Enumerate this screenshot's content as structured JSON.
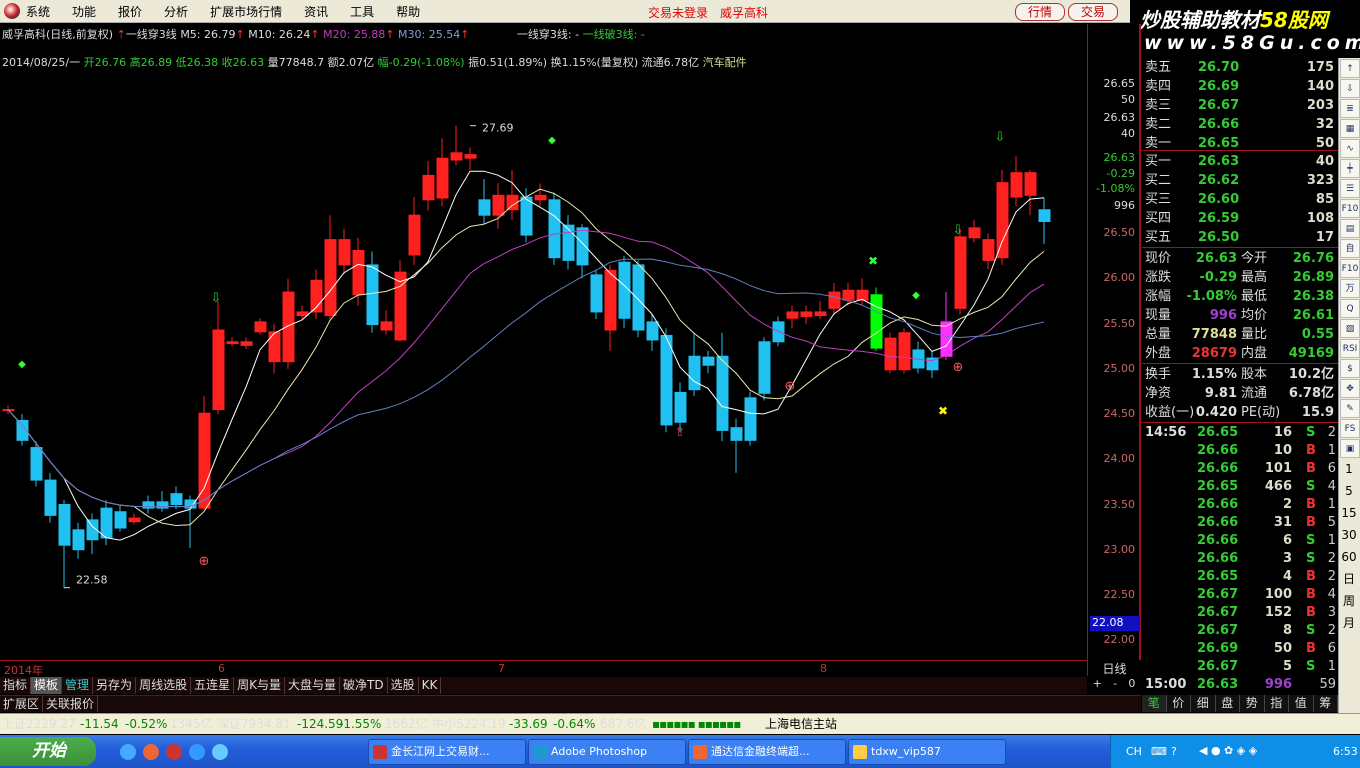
{
  "menu": {
    "items": [
      "系统",
      "功能",
      "报价",
      "分析",
      "扩展市场行情",
      "资讯",
      "工具",
      "帮助"
    ],
    "status": "交易未登录",
    "stock": "威孚高科",
    "btn_quote": "行情",
    "btn_trade": "交易"
  },
  "watermark": {
    "line1_a": "炒股辅助教材",
    "line1_b": "58股网",
    "line2": "www.58Gu.com"
  },
  "info_line1": {
    "title": "威孚高科(日线,前复权)",
    "ind1": "一线穿3线",
    "m5": "M5: 26.79",
    "m10": "M10: 26.24",
    "m20": "M20: 25.88",
    "m30": "M30: 25.54",
    "sig_a": "一线穿3线: -",
    "sig_b": "一线破3线: -"
  },
  "info_line2": {
    "date": "2014/08/25/一",
    "open": "开26.76",
    "high": "高26.89",
    "low": "低26.38",
    "close": "收26.63",
    "vol": "量77848.7",
    "amt": "额2.07亿",
    "chg": "幅-0.29(-1.08%)",
    "amp": "振0.51(1.89%)",
    "turn": "换1.15%(量复权)",
    "float": "流通6.78亿",
    "sector": "汽车配件"
  },
  "colors": {
    "up": "#ff2020",
    "down": "#20c0f0",
    "ma5": "#ffffff",
    "ma10": "#e8e8b0",
    "ma20": "#c040c0",
    "ma30": "#6080c0",
    "special_green": "#00ff00",
    "special_magenta": "#ff30ff"
  },
  "chart_data": {
    "type": "candlestick",
    "ylim": [
      21.85,
      28.2
    ],
    "y_ticks": [
      "26.50",
      "26.00",
      "25.50",
      "25.00",
      "24.50",
      "24.00",
      "23.50",
      "23.00",
      "22.50",
      "22.00"
    ],
    "y_tick_values": [
      26.5,
      26.0,
      25.5,
      25.0,
      24.5,
      24.0,
      23.5,
      23.0,
      22.5,
      22.0
    ],
    "x_labels": [
      "2014年",
      "6",
      "7",
      "8"
    ],
    "x_label_index": [
      0,
      15,
      35,
      58
    ],
    "high_label": "27.69",
    "high_index": 33,
    "low_label": "22.58",
    "low_index": 4,
    "ohlc": [
      [
        24.54,
        24.55,
        24.6,
        24.5
      ],
      [
        24.43,
        24.21,
        24.5,
        24.15
      ],
      [
        24.13,
        23.77,
        24.2,
        23.7
      ],
      [
        23.77,
        23.38,
        23.85,
        23.3
      ],
      [
        23.5,
        23.05,
        23.55,
        22.58
      ],
      [
        23.22,
        23.0,
        23.3,
        22.9
      ],
      [
        23.33,
        23.11,
        23.4,
        22.95
      ],
      [
        23.46,
        23.13,
        23.55,
        23.05
      ],
      [
        23.42,
        23.24,
        23.5,
        23.2
      ],
      [
        23.31,
        23.35,
        23.4,
        23.28
      ],
      [
        23.53,
        23.46,
        23.6,
        23.4
      ],
      [
        23.53,
        23.46,
        23.65,
        23.42
      ],
      [
        23.62,
        23.5,
        23.7,
        23.45
      ],
      [
        23.55,
        23.46,
        23.6,
        23.02
      ],
      [
        23.46,
        24.51,
        24.7,
        23.44
      ],
      [
        24.55,
        25.43,
        25.75,
        24.5
      ],
      [
        25.28,
        25.3,
        25.35,
        25.25
      ],
      [
        25.26,
        25.3,
        25.35,
        25.22
      ],
      [
        25.41,
        25.52,
        25.56,
        25.38
      ],
      [
        25.08,
        25.41,
        25.5,
        24.95
      ],
      [
        25.08,
        25.85,
        26.0,
        25.0
      ],
      [
        25.59,
        25.63,
        25.7,
        25.55
      ],
      [
        25.63,
        25.98,
        26.1,
        25.55
      ],
      [
        25.59,
        26.43,
        26.7,
        25.55
      ],
      [
        26.15,
        26.43,
        26.55,
        26.05
      ],
      [
        25.82,
        26.31,
        26.45,
        25.7
      ],
      [
        26.15,
        25.49,
        26.3,
        25.4
      ],
      [
        25.43,
        25.52,
        25.65,
        25.38
      ],
      [
        25.32,
        26.07,
        26.2,
        25.3
      ],
      [
        26.26,
        26.7,
        26.9,
        26.15
      ],
      [
        26.87,
        27.14,
        27.3,
        26.75
      ],
      [
        26.89,
        27.33,
        27.55,
        26.8
      ],
      [
        27.31,
        27.39,
        27.69,
        27.25
      ],
      [
        27.33,
        27.37,
        27.45,
        27.2
      ],
      [
        26.87,
        26.7,
        27.1,
        26.6
      ],
      [
        26.7,
        26.92,
        27.05,
        26.55
      ],
      [
        26.76,
        26.92,
        27.2,
        26.65
      ],
      [
        26.9,
        26.48,
        27.0,
        26.4
      ],
      [
        26.87,
        26.92,
        27.05,
        26.8
      ],
      [
        26.87,
        26.23,
        26.95,
        26.15
      ],
      [
        26.59,
        26.2,
        26.7,
        26.1
      ],
      [
        26.56,
        26.15,
        26.6,
        26.0
      ],
      [
        26.04,
        25.63,
        26.1,
        25.55
      ],
      [
        25.43,
        26.09,
        26.15,
        25.2
      ],
      [
        26.18,
        25.56,
        26.25,
        25.45
      ],
      [
        26.15,
        25.43,
        26.2,
        25.35
      ],
      [
        25.52,
        25.32,
        25.6,
        25.2
      ],
      [
        25.37,
        24.38,
        25.45,
        24.3
      ],
      [
        24.74,
        24.41,
        24.85,
        24.3
      ],
      [
        25.14,
        24.77,
        25.4,
        24.7
      ],
      [
        25.13,
        25.04,
        25.2,
        24.95
      ],
      [
        25.14,
        24.32,
        25.4,
        24.2
      ],
      [
        24.35,
        24.21,
        24.45,
        23.85
      ],
      [
        24.68,
        24.21,
        24.75,
        24.15
      ],
      [
        25.3,
        24.73,
        25.35,
        24.65
      ],
      [
        25.52,
        25.3,
        25.58,
        25.25
      ],
      [
        25.56,
        25.63,
        25.7,
        25.45
      ],
      [
        25.58,
        25.63,
        25.7,
        25.5
      ],
      [
        25.59,
        25.63,
        25.75,
        25.55
      ],
      [
        25.67,
        25.85,
        25.95,
        25.6
      ],
      [
        25.76,
        25.87,
        25.95,
        25.7
      ],
      [
        25.76,
        25.87,
        26.0,
        25.7
      ],
      [
        25.82,
        25.23,
        25.9,
        25.2
      ],
      [
        24.99,
        25.34,
        25.4,
        24.95
      ],
      [
        24.99,
        25.4,
        25.45,
        24.95
      ],
      [
        25.21,
        25.01,
        25.3,
        24.95
      ],
      [
        25.12,
        24.99,
        25.2,
        24.9
      ],
      [
        25.14,
        25.52,
        25.85,
        25.1
      ],
      [
        25.67,
        26.46,
        26.55,
        25.6
      ],
      [
        26.45,
        26.56,
        26.65,
        26.4
      ],
      [
        26.2,
        26.43,
        26.5,
        26.1
      ],
      [
        26.23,
        27.06,
        27.2,
        26.15
      ],
      [
        26.9,
        27.17,
        27.35,
        26.8
      ],
      [
        26.92,
        27.17,
        27.2,
        26.7
      ],
      [
        26.76,
        26.63,
        26.89,
        26.38
      ]
    ],
    "special": {
      "62": "special_green",
      "67": "special_magenta"
    },
    "ma_periods": [
      5,
      10,
      20,
      30
    ]
  },
  "yaxis": {
    "top_block": [
      "26.65",
      "50",
      "26.63",
      "40",
      "26.63",
      "-0.29",
      "-1.08%",
      "996"
    ],
    "current": "22.08",
    "dayline": "日线",
    "zoom": [
      "+",
      "-",
      "0"
    ]
  },
  "orderbook": {
    "sells": [
      {
        "label": "卖五",
        "price": "26.70",
        "vol": "175"
      },
      {
        "label": "卖四",
        "price": "26.69",
        "vol": "140"
      },
      {
        "label": "卖三",
        "price": "26.67",
        "vol": "203"
      },
      {
        "label": "卖二",
        "price": "26.66",
        "vol": "32"
      },
      {
        "label": "卖一",
        "price": "26.65",
        "vol": "50"
      }
    ],
    "buys": [
      {
        "label": "买一",
        "price": "26.63",
        "vol": "40"
      },
      {
        "label": "买二",
        "price": "26.62",
        "vol": "323"
      },
      {
        "label": "买三",
        "price": "26.60",
        "vol": "85"
      },
      {
        "label": "买四",
        "price": "26.59",
        "vol": "108"
      },
      {
        "label": "买五",
        "price": "26.50",
        "vol": "17"
      }
    ]
  },
  "quote": [
    {
      "l": "现价",
      "a": "26.63",
      "ac": "#3c3",
      "l2": "今开",
      "b": "26.76"
    },
    {
      "l": "涨跌",
      "a": "-0.29",
      "ac": "#3c3",
      "l2": "最高",
      "b": "26.89"
    },
    {
      "l": "涨幅",
      "a": "-1.08%",
      "ac": "#3c3",
      "l2": "最低",
      "b": "26.38"
    },
    {
      "l": "现量",
      "a": "996",
      "ac": "#a040d0",
      "l2": "均价",
      "b": "26.61"
    },
    {
      "l": "总量",
      "a": "77848",
      "ac": "#dd9",
      "l2": "量比",
      "b": "0.55"
    },
    {
      "l": "外盘",
      "a": "28679",
      "ac": "#e33",
      "l2": "内盘",
      "b": "49169"
    }
  ],
  "fund": [
    {
      "l": "换手",
      "a": "1.15%",
      "l2": "股本",
      "b": "10.2亿"
    },
    {
      "l": "净资",
      "a": "9.81",
      "l2": "流通",
      "b": "6.78亿"
    },
    {
      "l": "收益(一)",
      "a": "0.420",
      "l2": "PE(动)",
      "b": "15.9"
    }
  ],
  "ticks": [
    {
      "t": "14:56",
      "p": "26.65",
      "v": "16",
      "s": "S",
      "n": "2"
    },
    {
      "t": "",
      "p": "26.66",
      "v": "10",
      "s": "B",
      "n": "1"
    },
    {
      "t": "",
      "p": "26.66",
      "v": "101",
      "s": "B",
      "n": "6"
    },
    {
      "t": "",
      "p": "26.65",
      "v": "466",
      "s": "S",
      "n": "4"
    },
    {
      "t": "",
      "p": "26.66",
      "v": "2",
      "s": "B",
      "n": "1"
    },
    {
      "t": "",
      "p": "26.66",
      "v": "31",
      "s": "B",
      "n": "5"
    },
    {
      "t": "",
      "p": "26.66",
      "v": "6",
      "s": "S",
      "n": "1"
    },
    {
      "t": "",
      "p": "26.66",
      "v": "3",
      "s": "S",
      "n": "2"
    },
    {
      "t": "",
      "p": "26.65",
      "v": "4",
      "s": "B",
      "n": "2"
    },
    {
      "t": "",
      "p": "26.67",
      "v": "100",
      "s": "B",
      "n": "4"
    },
    {
      "t": "",
      "p": "26.67",
      "v": "152",
      "s": "B",
      "n": "3"
    },
    {
      "t": "",
      "p": "26.67",
      "v": "8",
      "s": "S",
      "n": "2"
    },
    {
      "t": "",
      "p": "26.69",
      "v": "50",
      "s": "B",
      "n": "6"
    },
    {
      "t": "",
      "p": "26.67",
      "v": "5",
      "s": "S",
      "n": "1"
    },
    {
      "t": "15:00",
      "p": "26.63",
      "v": "996",
      "s": "",
      "n": "59"
    }
  ],
  "rp_tabs": [
    "笔",
    "价",
    "细",
    "盘",
    "势",
    "指",
    "值",
    "筹"
  ],
  "sidebar": {
    "icons": [
      "↑",
      "⇩",
      "≣",
      "▦",
      "∿",
      "┿",
      "☰",
      "F10",
      "▤",
      "自",
      "F10",
      "万",
      "Q",
      "▨",
      "RSI",
      "$",
      "✥",
      "✎",
      "FS",
      "▣"
    ],
    "periods": [
      "1",
      "5",
      "15",
      "30",
      "60",
      "日",
      "周",
      "月"
    ]
  },
  "bottom_tabs": [
    "指标",
    "模板",
    "管理",
    "另存为",
    "周线选股",
    "五连星",
    "周K与量",
    "大盘与量",
    "破净TD",
    "选股",
    "KK"
  ],
  "ext_tabs": [
    "扩展区",
    "关联报价"
  ],
  "indices": {
    "sh": "上证2229.27",
    "sh_chg": "-11.54",
    "sh_pct": "-0.52%",
    "sh_amt": "1345亿",
    "sz": "深证7934.81",
    "sz_chg": "-124.59",
    "sz_pct": "-1.55%",
    "sz_amt": "1662亿",
    "zx": "中小5224.19",
    "zx_chg": "-33.69",
    "zx_pct": "-0.64%",
    "zx_amt": "687.6亿",
    "server": "上海电信主站"
  },
  "taskbar": {
    "start": "开始",
    "tasks": [
      "金长江网上交易财...",
      "Adobe Photoshop",
      "通达信金融终端超...",
      "tdxw_vip587"
    ],
    "lang": "CH",
    "time": "6:53"
  }
}
